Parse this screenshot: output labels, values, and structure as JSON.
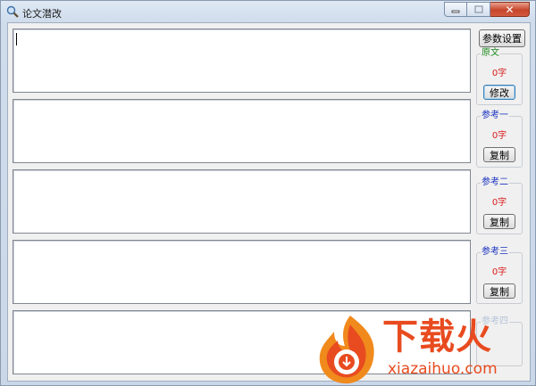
{
  "window": {
    "title": "论文潜改",
    "close_glyph": "✕"
  },
  "toolbar": {
    "settings_label": "参数设置"
  },
  "groups": [
    {
      "label": "原文",
      "count": "0字",
      "button": "修改",
      "label_color": "#1c8a1c"
    },
    {
      "label": "参考一",
      "count": "0字",
      "button": "复制",
      "label_color": "#1a32c0"
    },
    {
      "label": "参考二",
      "count": "0字",
      "button": "复制",
      "label_color": "#1a32c0"
    },
    {
      "label": "参考三",
      "count": "0字",
      "button": "复制",
      "label_color": "#1a32c0"
    },
    {
      "label": "参考四"
    }
  ],
  "textboxes": [
    "",
    "",
    "",
    "",
    ""
  ],
  "watermark": {
    "brand": "下载火",
    "url": "xiazaihuo.com",
    "brand_color": "#e84b1f"
  },
  "icons": {
    "app": "magnifier-icon",
    "minimize": "minimize-icon",
    "maximize": "maximize-icon",
    "close": "close-icon",
    "logo": "flame-logo-icon"
  }
}
